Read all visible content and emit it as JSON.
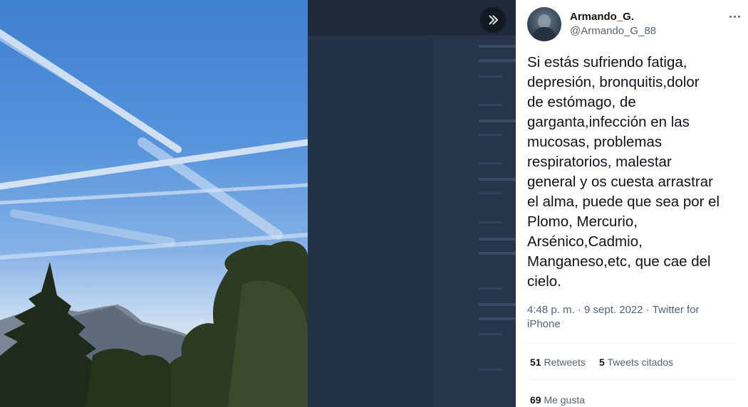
{
  "tweet": {
    "display_name": "Armando_G.",
    "handle": "@Armando_G_88",
    "text": "Si estás sufriendo fatiga,\ndepresión, bronquitis,dolor\nde estómago, de\ngarganta,infección en las\nmucosas, problemas\nrespiratorios, malestar\ngeneral y os cuesta arrastrar\nel alma, puede que sea por el\nPlomo, Mercurio,\nArsénico,Cadmio,\nManganeso,etc, que cae del\ncielo.",
    "time": "4:48 p. m.",
    "separator": " · ",
    "date": "9 sept. 2022",
    "source": "Twitter for iPhone",
    "retweets_count": "51",
    "retweets_label": "Retweets",
    "quotes_count": "5",
    "quotes_label": "Tweets citados",
    "likes_count": "69",
    "likes_label": "Me gusta"
  },
  "icons": {
    "expand": "chevron-double-right-icon",
    "more": "more-horizontal-icon"
  },
  "colors": {
    "text_primary": "#0f1419",
    "text_secondary": "#536471",
    "overlay": "#1e2a3b"
  }
}
